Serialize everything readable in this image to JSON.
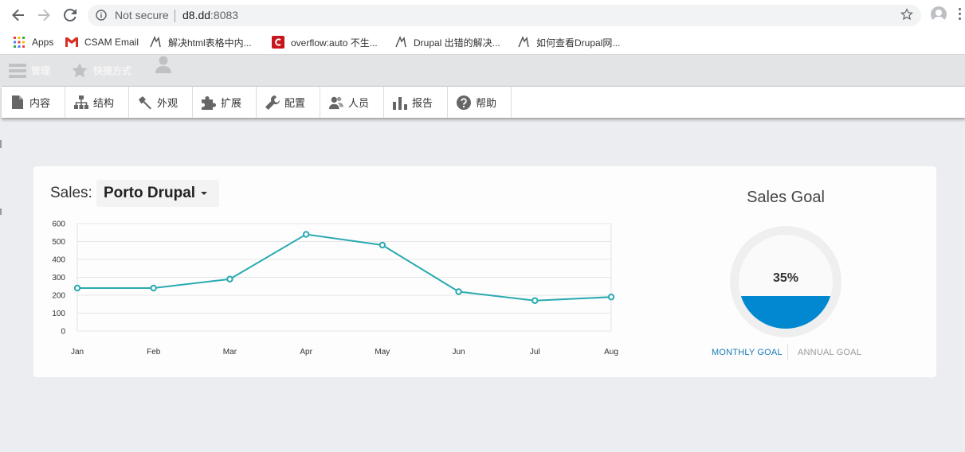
{
  "browser": {
    "security_text": "Not secure",
    "host": "d8.dd",
    "port": ":8083",
    "bookmarks": [
      {
        "label": "Apps",
        "icon": "apps-grid-icon"
      },
      {
        "label": "CSAM Email",
        "icon": "gmail-icon"
      },
      {
        "label": "解决html表格中内...",
        "icon": "page-icon"
      },
      {
        "label": "overflow:auto 不生...",
        "icon": "csdn-icon"
      },
      {
        "label": "Drupal 出错的解决...",
        "icon": "page-icon"
      },
      {
        "label": "如何查看Drupal网...",
        "icon": "page-icon"
      }
    ]
  },
  "toolbar": {
    "manage_label": "管理",
    "shortcuts_label": "快捷方式",
    "tray_items": [
      {
        "label": "内容",
        "icon": "file-icon"
      },
      {
        "label": "结构",
        "icon": "sitemap-icon"
      },
      {
        "label": "外观",
        "icon": "paintbrush-icon"
      },
      {
        "label": "扩展",
        "icon": "puzzle-icon"
      },
      {
        "label": "配置",
        "icon": "wrench-icon"
      },
      {
        "label": "人员",
        "icon": "people-icon"
      },
      {
        "label": "报告",
        "icon": "bar-chart-icon"
      },
      {
        "label": "帮助",
        "icon": "help-icon"
      }
    ]
  },
  "sales": {
    "label": "Sales:",
    "selected": "Porto Drupal"
  },
  "chart_data": {
    "type": "line",
    "categories": [
      "Jan",
      "Feb",
      "Mar",
      "Apr",
      "May",
      "Jun",
      "Jul",
      "Aug"
    ],
    "values": [
      240,
      240,
      290,
      540,
      480,
      220,
      170,
      190
    ],
    "ylim": [
      0,
      600
    ],
    "yticks": [
      "600",
      "500",
      "400",
      "300",
      "200",
      "100",
      "0"
    ],
    "grid": true,
    "color": "#2baab1"
  },
  "goal": {
    "title": "Sales Goal",
    "value_text": "35%",
    "fraction": 0.35,
    "fill_color": "#0288d1",
    "tabs": [
      "MONTHLY GOAL",
      "ANNUAL GOAL"
    ]
  }
}
